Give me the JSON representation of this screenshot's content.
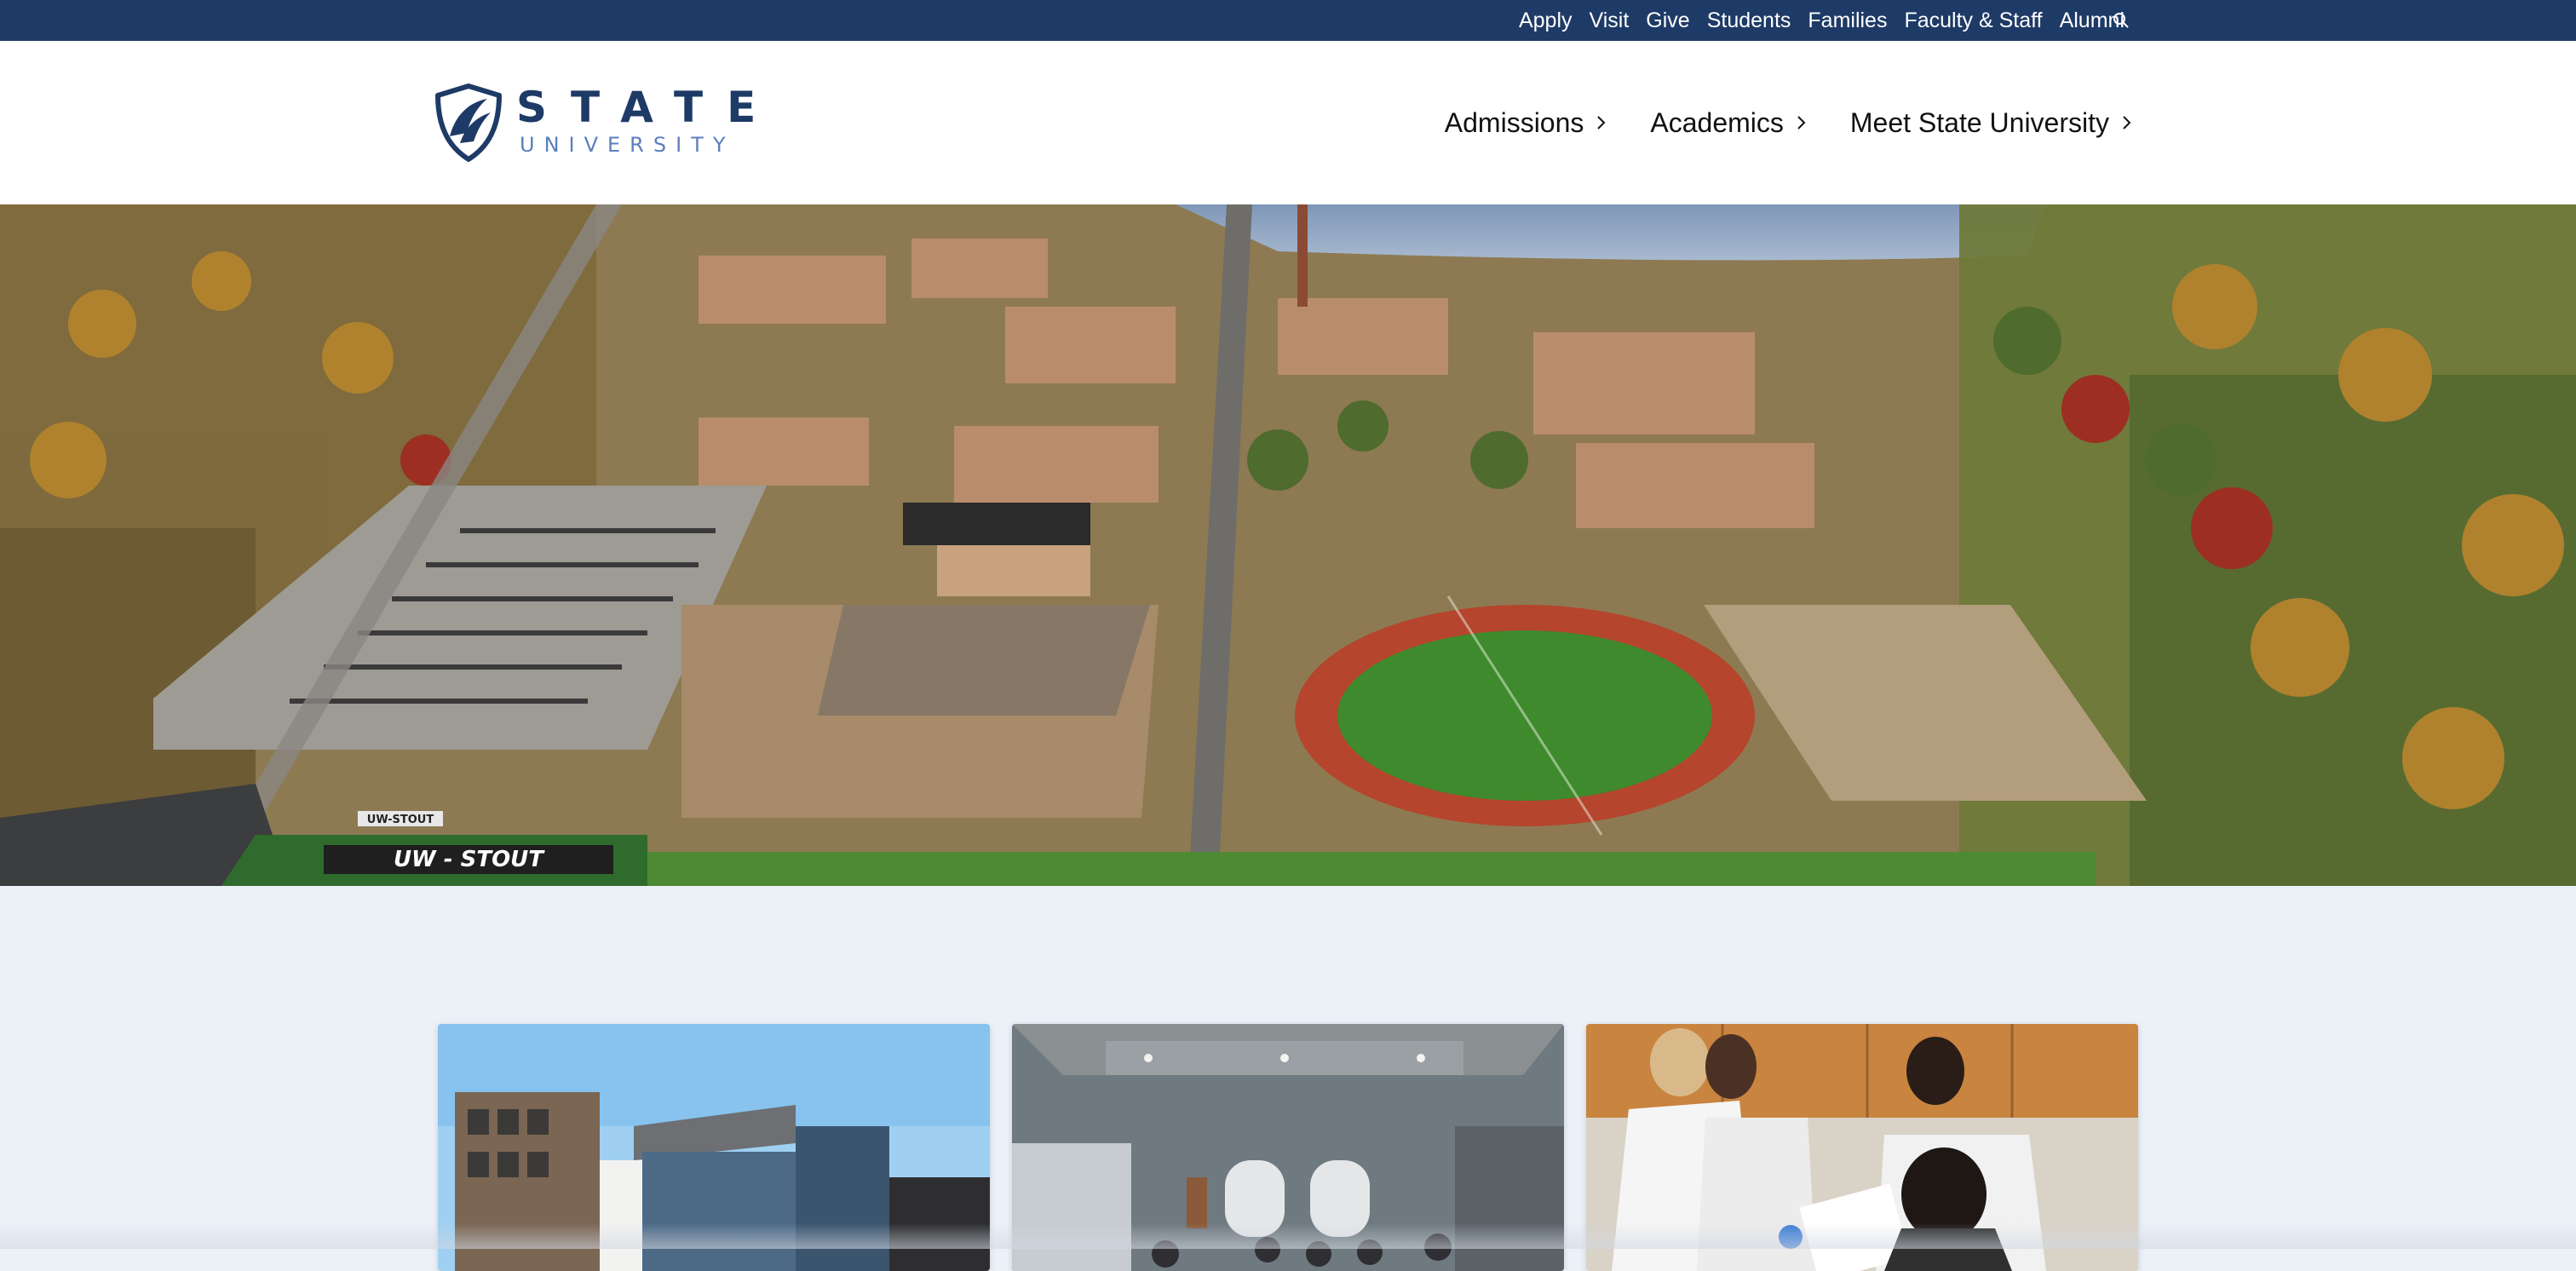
{
  "utility_nav": {
    "links": [
      "Apply",
      "Visit",
      "Give",
      "Students",
      "Families",
      "Faculty & Staff",
      "Alumni"
    ],
    "search_icon": "search-icon"
  },
  "logo": {
    "line1": "STATE",
    "line2": "UNIVERSITY"
  },
  "main_nav": {
    "items": [
      {
        "label": "Admissions",
        "icon": "chevron-right-icon"
      },
      {
        "label": "Academics",
        "icon": "chevron-right-icon"
      },
      {
        "label": "Meet State University",
        "icon": "chevron-right-icon"
      }
    ]
  },
  "hero": {
    "image": "aerial-campus-photo",
    "field_sign": "UW - STOUT",
    "stands_sign": "UW-STOUT"
  },
  "cards": [
    {
      "image": "campus-building-photo"
    },
    {
      "image": "lecture-hall-photo"
    },
    {
      "image": "science-lab-students-photo"
    }
  ],
  "colors": {
    "utility_bar": "#1e3a66",
    "brand_navy": "#1e3a66",
    "brand_light_blue": "#5b7fbb",
    "page_background": "#ecf1f8"
  }
}
